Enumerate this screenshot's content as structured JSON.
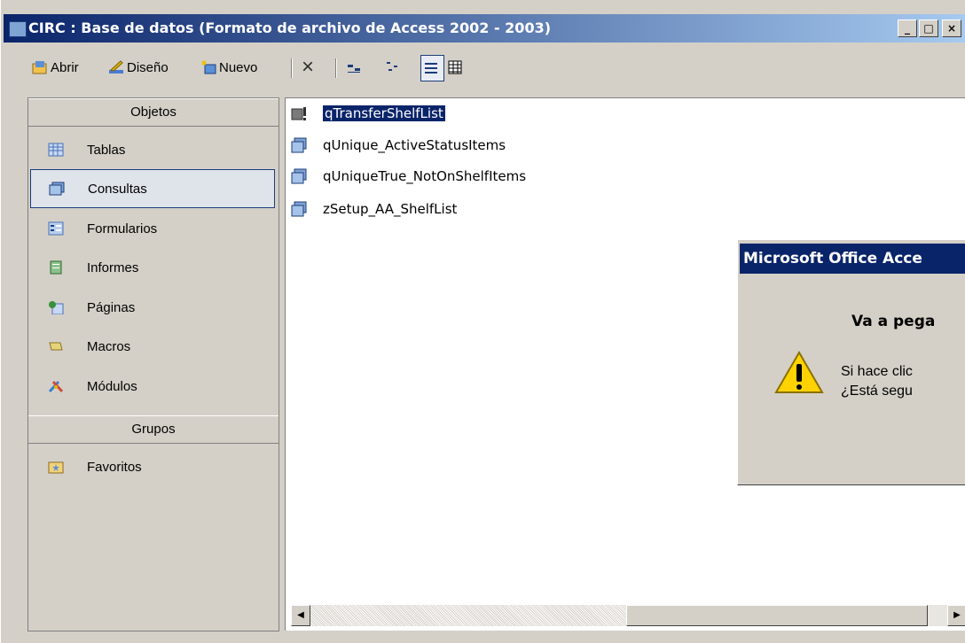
{
  "window": {
    "title": "CIRC : Base de datos (Formato de archivo de Access 2002 - 2003)",
    "controls": [
      "_",
      "□",
      "×"
    ]
  },
  "toolbar": {
    "open_label": "Abrir",
    "design_label": "Diseño",
    "new_label": "Nuevo",
    "delete_icon": "×"
  },
  "sidebar": {
    "objects_header": "Objetos",
    "groups_header": "Grupos",
    "items": [
      {
        "label": "Tablas"
      },
      {
        "label": "Consultas"
      },
      {
        "label": "Formularios"
      },
      {
        "label": "Informes"
      },
      {
        "label": "Páginas"
      },
      {
        "label": "Macros"
      },
      {
        "label": "Módulos"
      }
    ],
    "groups": [
      {
        "label": "Favoritos"
      }
    ]
  },
  "list": {
    "items": [
      {
        "label": "qTransferShelfList",
        "selected": true
      },
      {
        "label": "qUnique_ActiveStatusItems"
      },
      {
        "label": "qUniqueTrue_NotOnShelfItems"
      },
      {
        "label": "zSetup_AA_ShelfList"
      }
    ]
  },
  "dialog": {
    "title": "Microsoft Office Acce",
    "heading": "Va a pega",
    "line1": "Si hace clic",
    "line2": "¿Está segu"
  },
  "colors": {
    "title_active": "#0a246a",
    "title_gradient_end": "#a6caf0",
    "face": "#d4d0c8",
    "selection": "#0a246a"
  }
}
